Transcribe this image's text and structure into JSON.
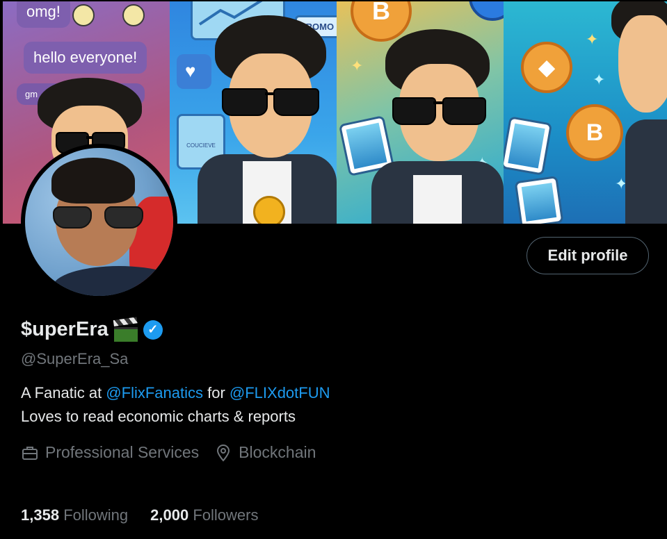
{
  "banner": {
    "chat_bubbles": [
      "omg!",
      "hello everyone!",
      "gm"
    ],
    "promo_label": "PROMO",
    "card_label": "COUCIEVE",
    "coin_symbol": "B"
  },
  "profile": {
    "display_name": "$uperEra",
    "handle": "@SuperEra_Sa",
    "verified": true,
    "edit_button_label": "Edit profile",
    "bio": {
      "line1_prefix": "A Fanatic at ",
      "mention1": "@FlixFanatics",
      "line1_middle": " for ",
      "mention2": "@FLIXdotFUN",
      "line2": "Loves to read economic charts & reports"
    },
    "meta": {
      "category": "Professional Services",
      "location": "Blockchain"
    },
    "stats": {
      "following_count": "1,358",
      "following_label": "Following",
      "followers_count": "2,000",
      "followers_label": "Followers"
    }
  },
  "colors": {
    "background": "#000000",
    "primary_text": "#e7e9ea",
    "secondary_text": "#71767b",
    "accent": "#1d9bf0",
    "button_border": "#536471"
  },
  "icons": {
    "category": "briefcase-icon",
    "location": "location-pin-icon",
    "verified": "verified-badge-icon",
    "name_emoji": "clapper-board-icon"
  }
}
